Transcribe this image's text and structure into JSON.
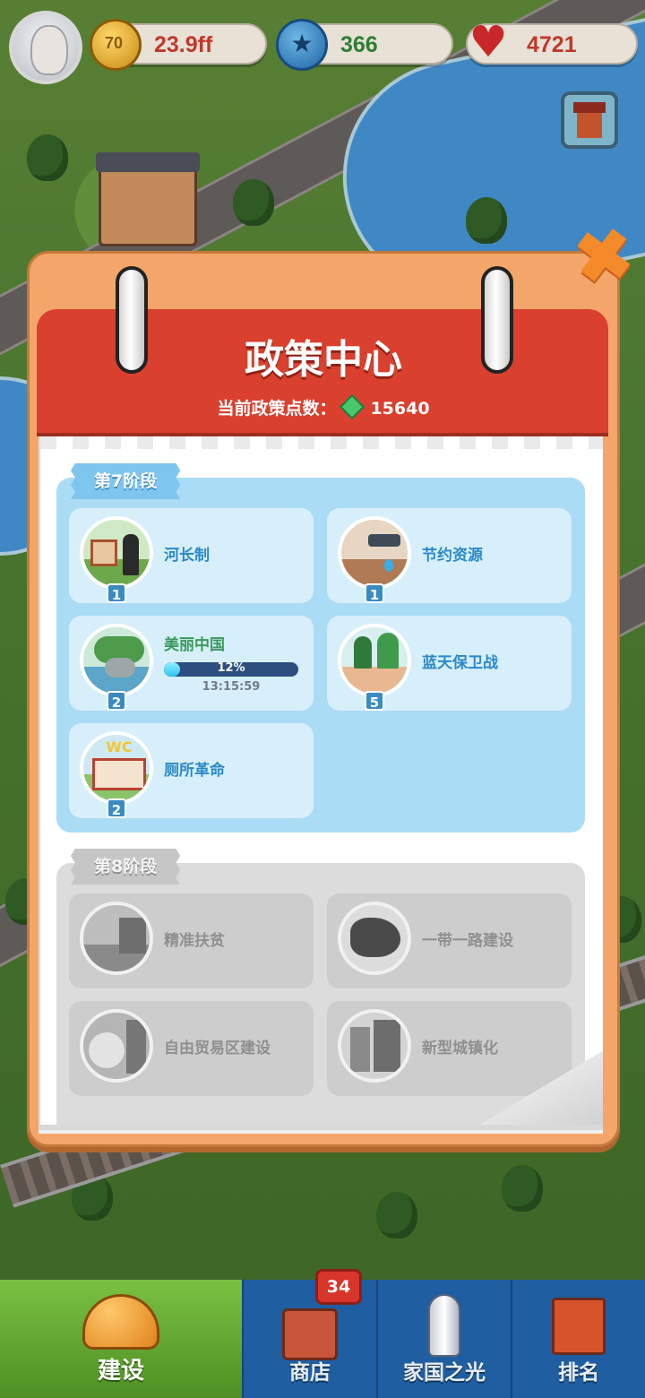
{
  "hud": {
    "coin_icon_glyph": "70",
    "coins": "23.9ff",
    "stars": "366",
    "hearts": "4721",
    "colors": {
      "coins_text": "#c0392b",
      "stars_text": "#2e7d32",
      "hearts_text": "#c0392b"
    }
  },
  "panel": {
    "title": "政策中心",
    "points_label": "当前政策点数：",
    "points_value": "15640"
  },
  "stages": [
    {
      "label": "第7阶段",
      "state": "unlocked",
      "policies": [
        {
          "name": "河长制",
          "level": "1"
        },
        {
          "name": "节约资源",
          "level": "1"
        },
        {
          "name": "美丽中国",
          "level": "2",
          "progress_percent": 12,
          "progress_text": "12%",
          "timer": "13:15:59"
        },
        {
          "name": "蓝天保卫战",
          "level": "5"
        },
        {
          "name": "厕所革命",
          "level": "2",
          "icon_text": "WC"
        }
      ]
    },
    {
      "label": "第8阶段",
      "state": "locked",
      "policies": [
        {
          "name": "精准扶贫"
        },
        {
          "name": "一带一路建设"
        },
        {
          "name": "自由贸易区建设"
        },
        {
          "name": "新型城镇化"
        }
      ]
    }
  ],
  "nav": {
    "items": [
      {
        "label": "建设",
        "active": true,
        "icon": "helmet-icon"
      },
      {
        "label": "商店",
        "icon": "shop-icon",
        "badge": "34"
      },
      {
        "label": "家国之光",
        "icon": "rocket-icon"
      },
      {
        "label": "排名",
        "icon": "ranking-icon"
      }
    ]
  }
}
